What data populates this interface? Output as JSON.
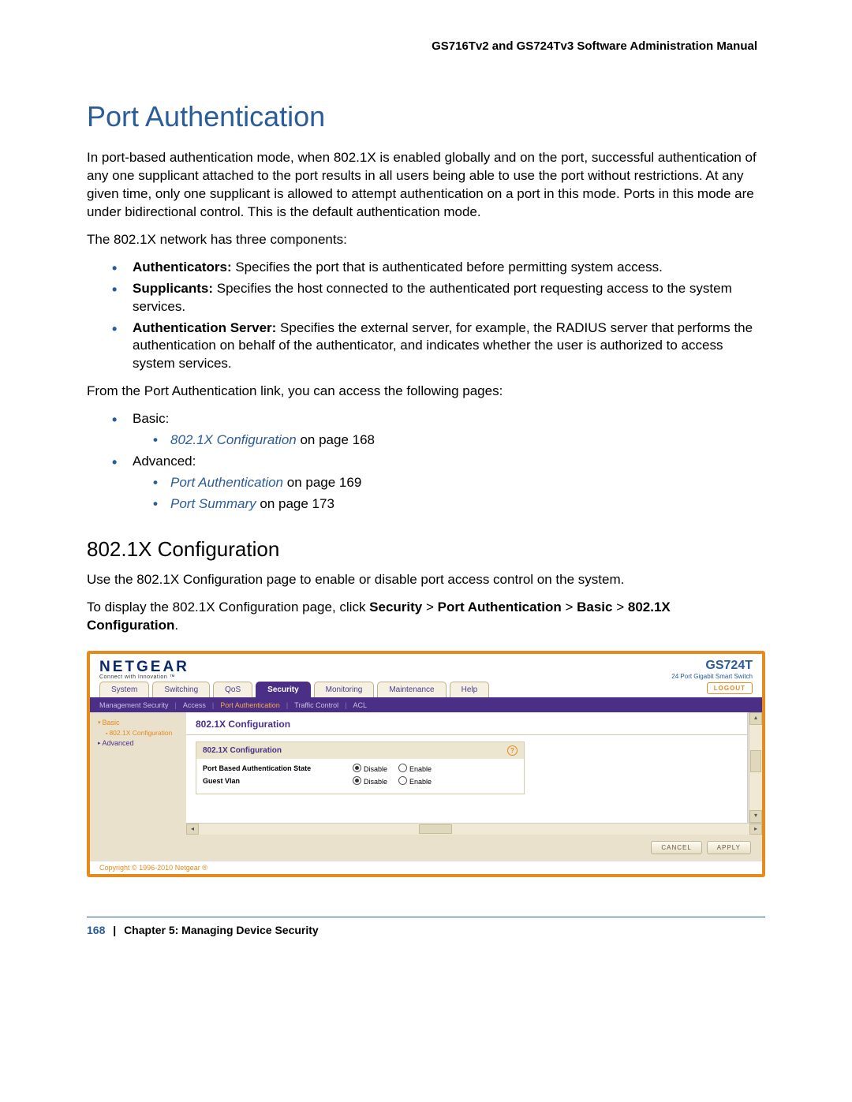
{
  "header": {
    "manual_title": "GS716Tv2 and GS724Tv3 Software Administration Manual"
  },
  "h1": "Port Authentication",
  "para1": "In port-based authentication mode, when 802.1X is enabled globally and on the port, successful authentication of any one supplicant attached to the port results in all users being able to use the port without restrictions. At any given time, only one supplicant is allowed to attempt authentication on a port in this mode. Ports in this mode are under bidirectional control. This is the default authentication mode.",
  "para2": "The 802.1X network has three components:",
  "bullets1": {
    "b1_bold": "Authenticators:",
    "b1_rest": " Specifies the port that is authenticated before permitting system access.",
    "b2_bold": "Supplicants:",
    "b2_rest": " Specifies the host connected to the authenticated port requesting access to the system services.",
    "b3_bold": "Authentication Server:",
    "b3_rest": " Specifies the external server, for example, the RADIUS server that performs the authentication on behalf of the authenticator, and indicates whether the user is authorized to access system services."
  },
  "para3": "From the Port Authentication link, you can access the following pages:",
  "bullets2": {
    "basic_label": "Basic:",
    "basic_link": "802.1X Configuration",
    "basic_tail": " on page 168",
    "adv_label": "Advanced:",
    "adv_link1": "Port Authentication",
    "adv_tail1": " on page 169",
    "adv_link2": "Port Summary",
    "adv_tail2": " on page 173"
  },
  "h2": "802.1X Configuration",
  "para4": "Use the 802.1X Configuration page to enable or disable port access control on the system.",
  "para5_a": "To display the 802.1X Configuration page, click ",
  "para5_b": "Security",
  "para5_gt": " > ",
  "para5_c": "Port Authentication",
  "para5_d": "Basic",
  "para5_e": "802.1X Configuration",
  "para5_tail": ".",
  "shot": {
    "brand": "NETGEAR",
    "tagline": "Connect with Innovation ™",
    "model": "GS724T",
    "model_sub": "24 Port Gigabit Smart Switch",
    "tabs": [
      "System",
      "Switching",
      "QoS",
      "Security",
      "Monitoring",
      "Maintenance",
      "Help"
    ],
    "active_tab_index": 3,
    "logout": "LOGOUT",
    "subnav": [
      "Management Security",
      "Access",
      "Port Authentication",
      "Traffic Control",
      "ACL"
    ],
    "subnav_active_index": 2,
    "sidenav": {
      "basic": "Basic",
      "sub": "802.1X Configuration",
      "advanced": "Advanced"
    },
    "pane_head": "802.1X Configuration",
    "panel_title": "802.1X Configuration",
    "field1": "Port Based Authentication State",
    "field2": "Guest Vlan",
    "disable": "Disable",
    "enable": "Enable",
    "cancel": "CANCEL",
    "apply": "APPLY",
    "copyright": "Copyright © 1996-2010 Netgear ®"
  },
  "footer": {
    "page": "168",
    "chapter": "Chapter 5:  Managing Device Security"
  },
  "sep_bar": "|"
}
